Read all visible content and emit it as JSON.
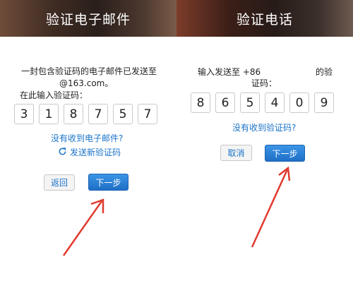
{
  "left": {
    "title": "验证电子邮件",
    "message_line1": "一封包含验证码的电子邮件已发送至",
    "message_line2": "@163.com。",
    "message_line3": "在此输入验证码：",
    "digits": [
      "3",
      "1",
      "8",
      "7",
      "5",
      "7"
    ],
    "no_email_link": "没有收到电子邮件?",
    "resend_link": "发送新验证码",
    "back_button": "返回",
    "next_button": "下一步"
  },
  "right": {
    "title": "验证电话",
    "message_prefix": "输入发送至 +86",
    "message_suffix": "的验",
    "message_line2": "证码：",
    "digits": [
      "8",
      "6",
      "5",
      "4",
      "0",
      "9"
    ],
    "no_code_link": "没有收到验证码?",
    "cancel_button": "取消",
    "next_button": "下一步"
  },
  "colors": {
    "link": "#1a73c8",
    "primary_button": "#2a82d8",
    "annotation_arrow": "#e03a2f"
  },
  "icons": {
    "resend": "refresh-icon",
    "annotation": "red-arrow"
  }
}
